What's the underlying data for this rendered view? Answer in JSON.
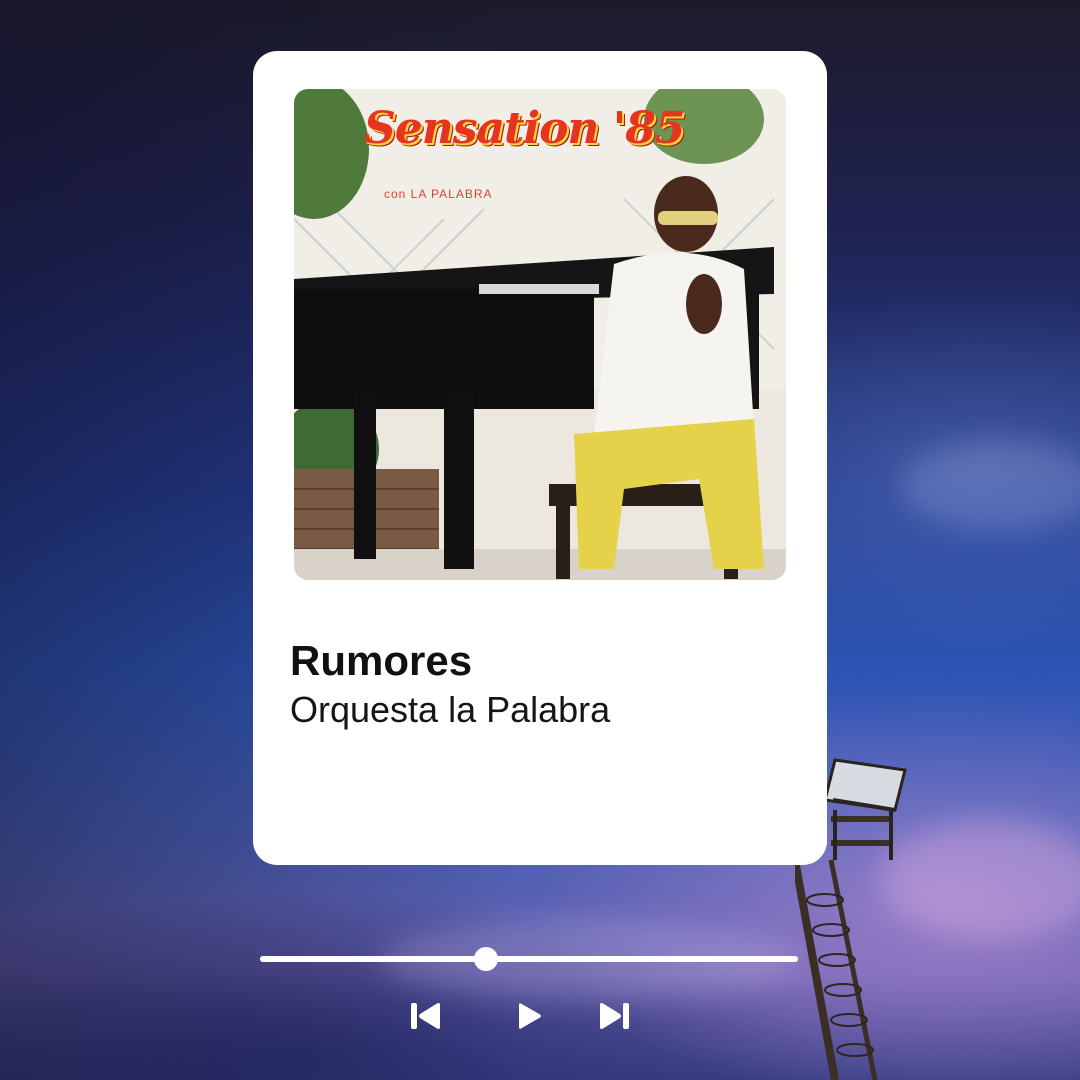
{
  "track": {
    "title": "Rumores",
    "artist": "Orquesta la Palabra"
  },
  "album_cover": {
    "title_text": "Sensation '85",
    "subtitle_text": "con LA PALABRA"
  },
  "player": {
    "progress_fraction": 0.42,
    "controls": {
      "previous_icon": "skip-previous-icon",
      "play_icon": "play-icon",
      "next_icon": "skip-next-icon"
    }
  },
  "colors": {
    "card_background": "#ffffff",
    "title_text": "#111111",
    "controls": "#ffffff",
    "cover_title_red": "#e5341f"
  }
}
